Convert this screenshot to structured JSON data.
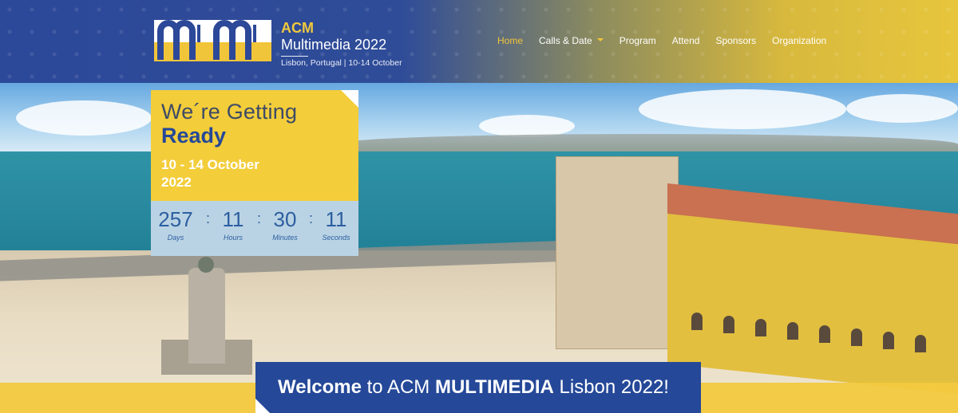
{
  "header": {
    "brand_acm": "ACM",
    "brand_title": "Multimedia 2022",
    "brand_location": "Lisbon, Portugal | 10-14 October",
    "logo_letters": "mm"
  },
  "nav": {
    "items": [
      {
        "label": "Home",
        "active": true
      },
      {
        "label": "Calls & Date",
        "dropdown": true
      },
      {
        "label": "Program"
      },
      {
        "label": "Attend"
      },
      {
        "label": "Sponsors"
      },
      {
        "label": "Organization"
      }
    ]
  },
  "countdown_card": {
    "line1": "We´re Getting",
    "line2": "Ready",
    "dates_line1": "10 - 14 October",
    "dates_line2": "2022",
    "timer": {
      "days": "257",
      "days_label": "Days",
      "hours": "11",
      "hours_label": "Hours",
      "minutes": "30",
      "minutes_label": "Minutes",
      "seconds": "11",
      "seconds_label": "Seconds"
    }
  },
  "welcome": {
    "part1": "Welcome",
    "part2": " to ACM ",
    "part3": "MULTIMEDIA",
    "part4": " Lisbon 2022!"
  },
  "colors": {
    "brand_blue": "#254898",
    "brand_yellow": "#f2c93f",
    "nav_active": "#f1c53a"
  }
}
